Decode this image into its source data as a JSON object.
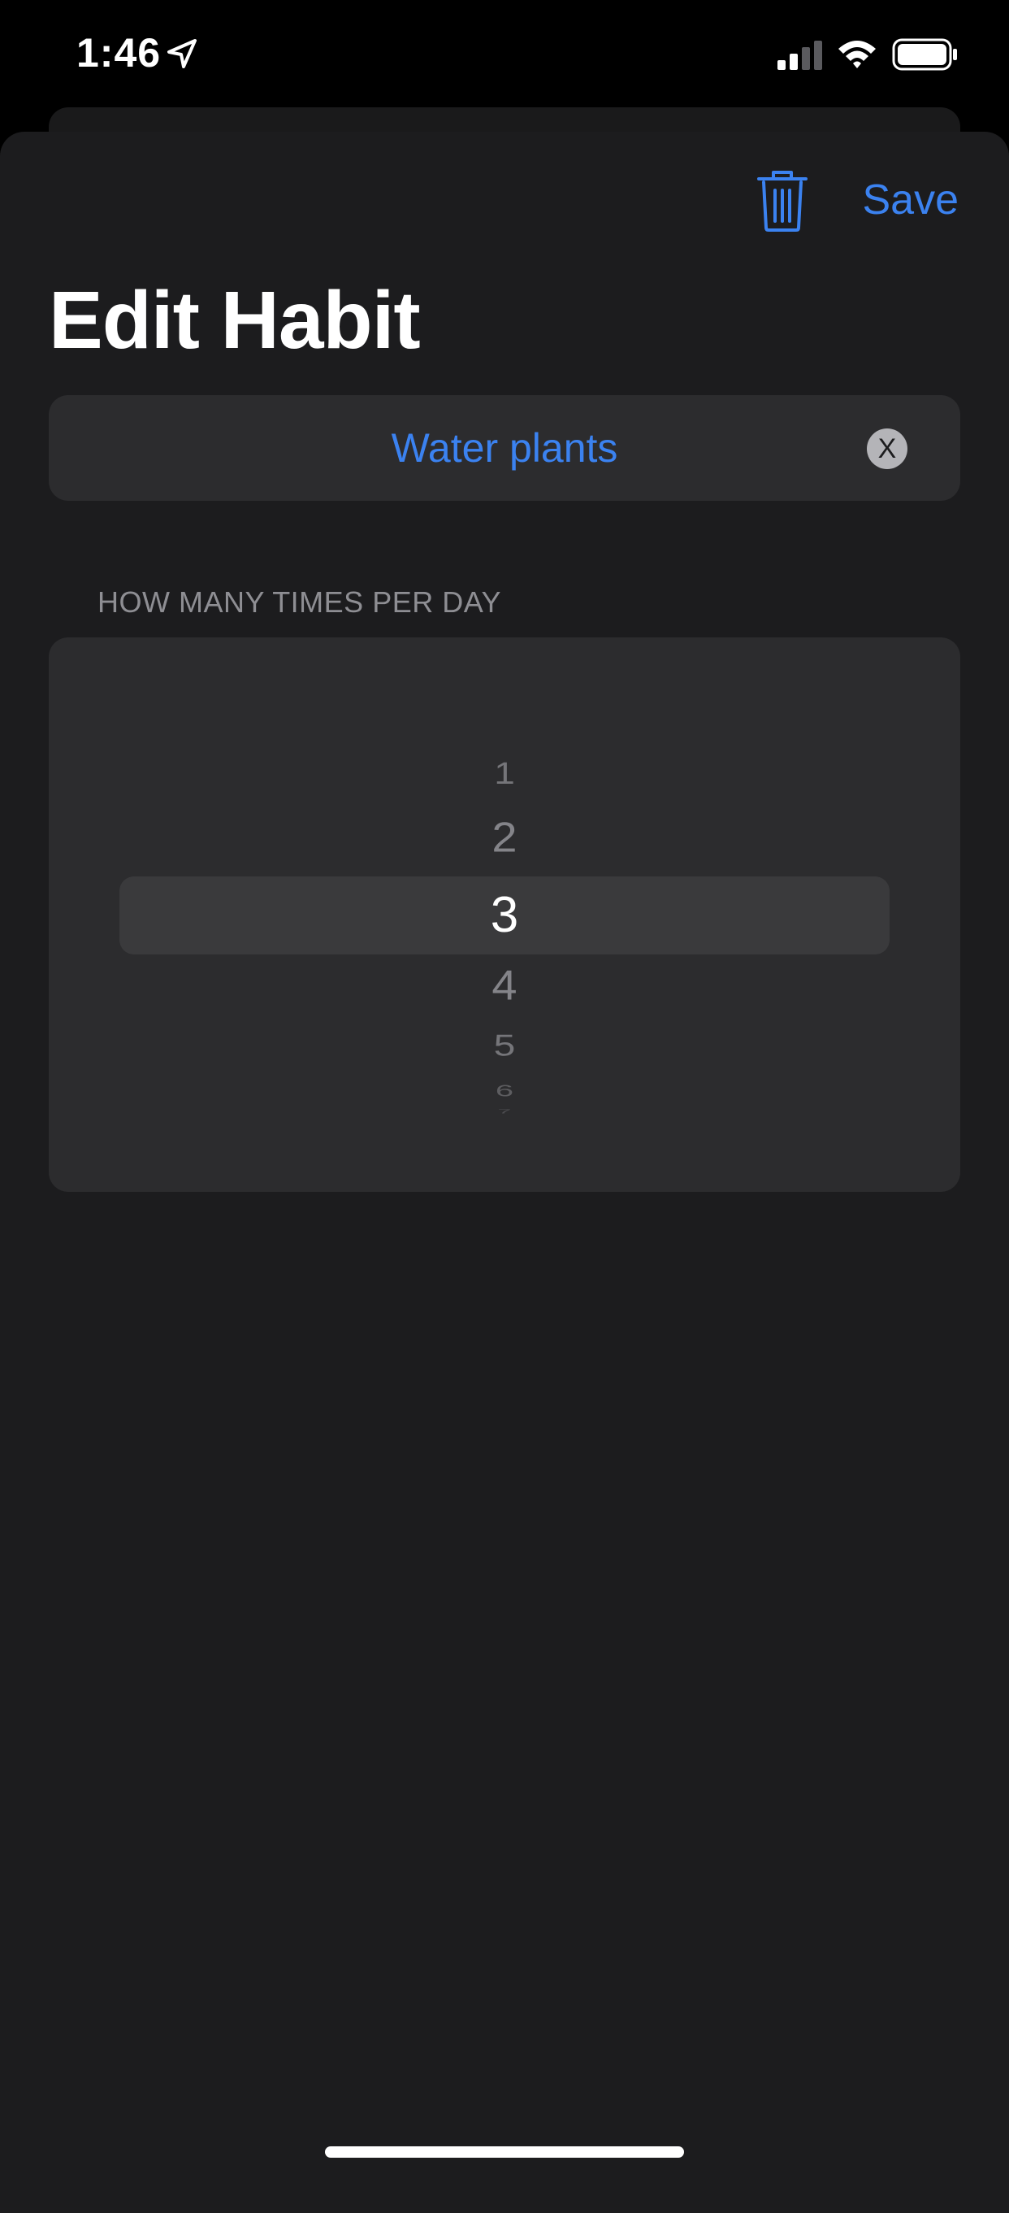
{
  "status_bar": {
    "time": "1:46",
    "icons": [
      "location-arrow-icon",
      "cellular-signal-icon",
      "wifi-icon",
      "battery-icon"
    ]
  },
  "header": {
    "save_label": "Save",
    "delete_icon": "trash-icon"
  },
  "title": "Edit Habit",
  "name_field": {
    "value": "Water plants",
    "clear_label": "X"
  },
  "frequency": {
    "section_label": "HOW MANY TIMES PER DAY",
    "options": [
      "1",
      "2",
      "3",
      "4",
      "5",
      "6",
      "7"
    ],
    "selected": "3"
  },
  "colors": {
    "accent": "#3b82f0",
    "background": "#000000",
    "sheet": "#1c1c1e",
    "card": "#2c2c2e",
    "picker_highlight": "#3a3a3c",
    "secondary_text": "#8e8e93"
  }
}
